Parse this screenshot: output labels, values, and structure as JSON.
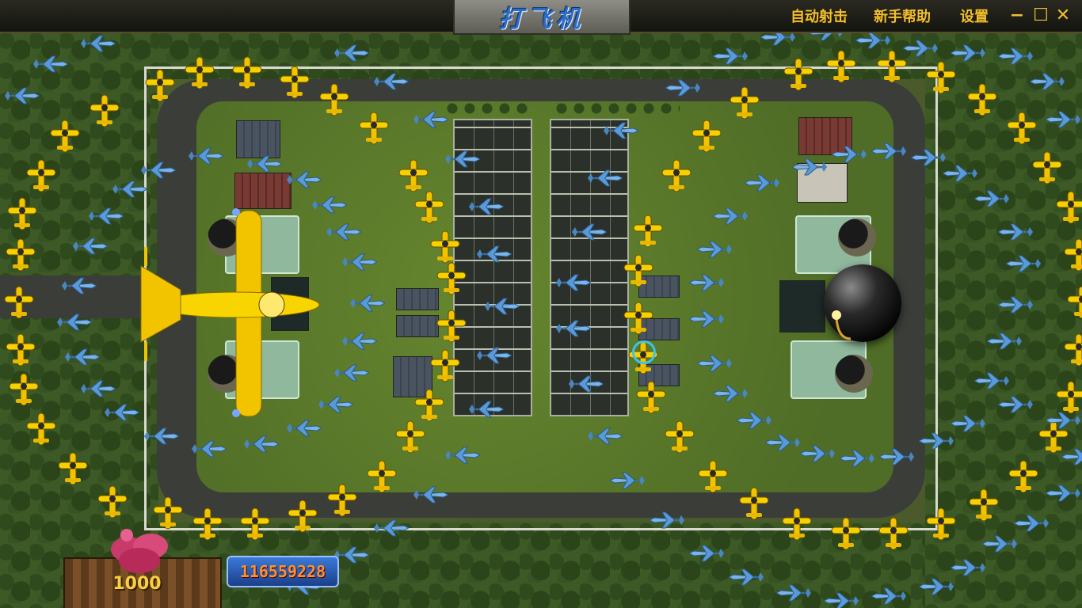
{
  "window": {
    "title": "打飞机",
    "menu": [
      "自动射击",
      "新手帮助",
      "设置"
    ],
    "controls": {
      "minimize": "−",
      "maximize": "☐",
      "close": "✕"
    }
  },
  "hud": {
    "bet": "1000",
    "credits": "116559228"
  },
  "icons": {
    "enemy_small": "yellow-propeller-plane-icon",
    "enemy_fighter": "blue-jet-fighter-icon",
    "boss": "bomb-icon",
    "player": "yellow-plane-icon",
    "cannon": "pink-cannon-icon"
  },
  "colors": {
    "menu_text": "#f0c030",
    "title_text": "#2a6cc8",
    "score_text": "#ff9030",
    "bet_text": "#f8d040"
  }
}
